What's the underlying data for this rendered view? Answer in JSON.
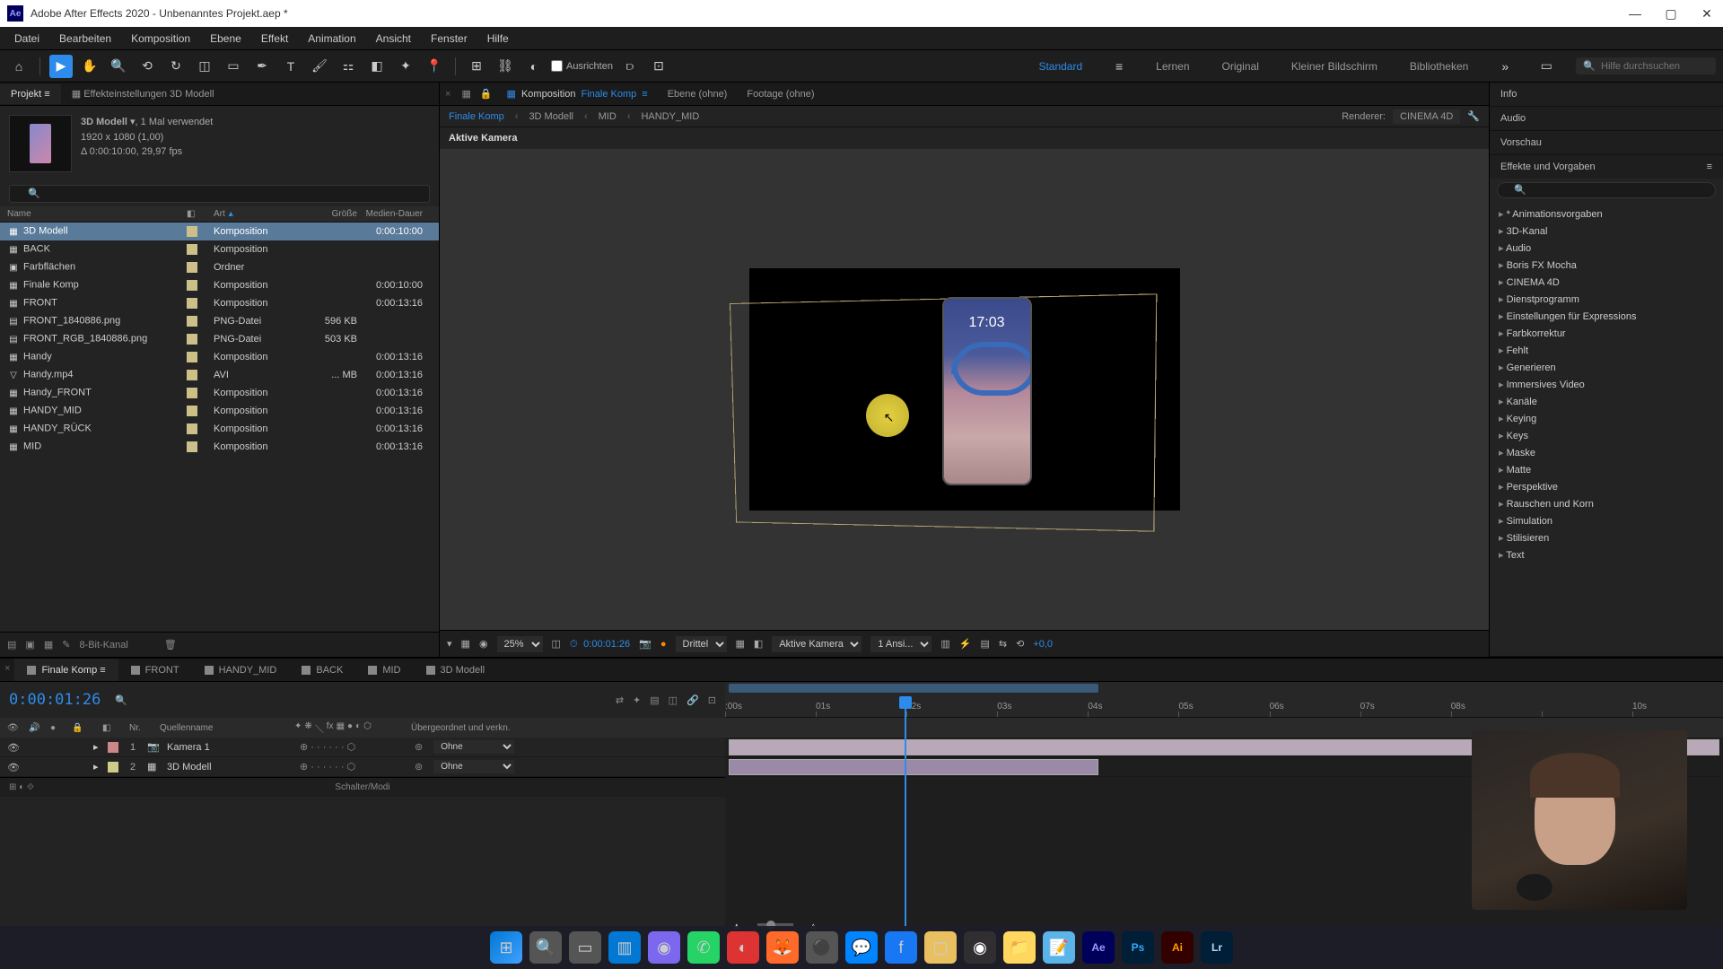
{
  "window": {
    "title": "Adobe After Effects 2020 - Unbenanntes Projekt.aep *",
    "app_icon": "Ae"
  },
  "menu": [
    "Datei",
    "Bearbeiten",
    "Komposition",
    "Ebene",
    "Effekt",
    "Animation",
    "Ansicht",
    "Fenster",
    "Hilfe"
  ],
  "toolbar": {
    "align_label": "Ausrichten"
  },
  "workspaces": {
    "items": [
      "Standard",
      "Lernen",
      "Original",
      "Kleiner Bildschirm",
      "Bibliotheken"
    ],
    "active": "Standard",
    "search_placeholder": "Hilfe durchsuchen"
  },
  "project": {
    "tab_project": "Projekt",
    "tab_effect": "Effekteinstellungen 3D Modell",
    "selected_name": "3D Modell",
    "selected_used": ", 1 Mal verwendet",
    "selected_res": "1920 x 1080 (1,00)",
    "selected_dur": "Δ 0:00:10:00, 29,97 fps",
    "search_placeholder": "",
    "headers": {
      "name": "Name",
      "type": "Art",
      "size": "Größe",
      "dur": "Medien-Dauer"
    },
    "bit_depth": "8-Bit-Kanal",
    "items": [
      {
        "name": "3D Modell",
        "type": "Komposition",
        "size": "",
        "dur": "0:00:10:00",
        "sel": true,
        "icon": "▦"
      },
      {
        "name": "BACK",
        "type": "Komposition",
        "size": "",
        "dur": "",
        "sel": false,
        "icon": "▦"
      },
      {
        "name": "Farbflächen",
        "type": "Ordner",
        "size": "",
        "dur": "",
        "sel": false,
        "icon": "▣"
      },
      {
        "name": "Finale Komp",
        "type": "Komposition",
        "size": "",
        "dur": "0:00:10:00",
        "sel": false,
        "icon": "▦"
      },
      {
        "name": "FRONT",
        "type": "Komposition",
        "size": "",
        "dur": "0:00:13:16",
        "sel": false,
        "icon": "▦"
      },
      {
        "name": "FRONT_1840886.png",
        "type": "PNG-Datei",
        "size": "596 KB",
        "dur": "",
        "sel": false,
        "icon": "▤"
      },
      {
        "name": "FRONT_RGB_1840886.png",
        "type": "PNG-Datei",
        "size": "503 KB",
        "dur": "",
        "sel": false,
        "icon": "▤"
      },
      {
        "name": "Handy",
        "type": "Komposition",
        "size": "",
        "dur": "0:00:13:16",
        "sel": false,
        "icon": "▦"
      },
      {
        "name": "Handy.mp4",
        "type": "AVI",
        "size": "... MB",
        "dur": "0:00:13:16",
        "sel": false,
        "icon": "▽"
      },
      {
        "name": "Handy_FRONT",
        "type": "Komposition",
        "size": "",
        "dur": "0:00:13:16",
        "sel": false,
        "icon": "▦"
      },
      {
        "name": "HANDY_MID",
        "type": "Komposition",
        "size": "",
        "dur": "0:00:13:16",
        "sel": false,
        "icon": "▦"
      },
      {
        "name": "HANDY_RÜCK",
        "type": "Komposition",
        "size": "",
        "dur": "0:00:13:16",
        "sel": false,
        "icon": "▦"
      },
      {
        "name": "MID",
        "type": "Komposition",
        "size": "",
        "dur": "0:00:13:16",
        "sel": false,
        "icon": "▦"
      }
    ]
  },
  "comp": {
    "tab_comp": "Komposition",
    "tab_comp_name": "Finale Komp",
    "tab_layer": "Ebene (ohne)",
    "tab_footage": "Footage (ohne)",
    "breadcrumb": [
      "Finale Komp",
      "3D Modell",
      "MID",
      "HANDY_MID"
    ],
    "renderer_label": "Renderer:",
    "renderer_value": "CINEMA 4D",
    "camera_label": "Aktive Kamera",
    "phone_time": "17:03",
    "footer": {
      "zoom": "25%",
      "timecode": "0:00:01:26",
      "resolution": "Drittel",
      "camera": "Aktive Kamera",
      "views": "1 Ansi...",
      "exposure": "+0,0"
    }
  },
  "right": {
    "info": "Info",
    "audio": "Audio",
    "preview": "Vorschau",
    "effects": "Effekte und Vorgaben",
    "presets": [
      "* Animationsvorgaben",
      "3D-Kanal",
      "Audio",
      "Boris FX Mocha",
      "CINEMA 4D",
      "Dienstprogramm",
      "Einstellungen für Expressions",
      "Farbkorrektur",
      "Fehlt",
      "Generieren",
      "Immersives Video",
      "Kanäle",
      "Keying",
      "Keys",
      "Maske",
      "Matte",
      "Perspektive",
      "Rauschen und Korn",
      "Simulation",
      "Stilisieren",
      "Text"
    ]
  },
  "timeline": {
    "tabs": [
      "Finale Komp",
      "FRONT",
      "HANDY_MID",
      "BACK",
      "MID",
      "3D Modell"
    ],
    "active_tab": "Finale Komp",
    "timecode": "0:00:01:26",
    "header_nr": "Nr.",
    "header_source": "Quellenname",
    "header_parent": "Übergeordnet und verkn.",
    "parent_none": "Ohne",
    "layers": [
      {
        "idx": "1",
        "name": "Kamera 1",
        "icon": "📷",
        "color": "#c88"
      },
      {
        "idx": "2",
        "name": "3D Modell",
        "icon": "▦",
        "color": "#cc8"
      }
    ],
    "ruler": [
      ":00s",
      "01s",
      "02s",
      "03s",
      "04s",
      "05s",
      "06s",
      "07s",
      "08s",
      "",
      "10s"
    ],
    "footer": "Schalter/Modi"
  }
}
